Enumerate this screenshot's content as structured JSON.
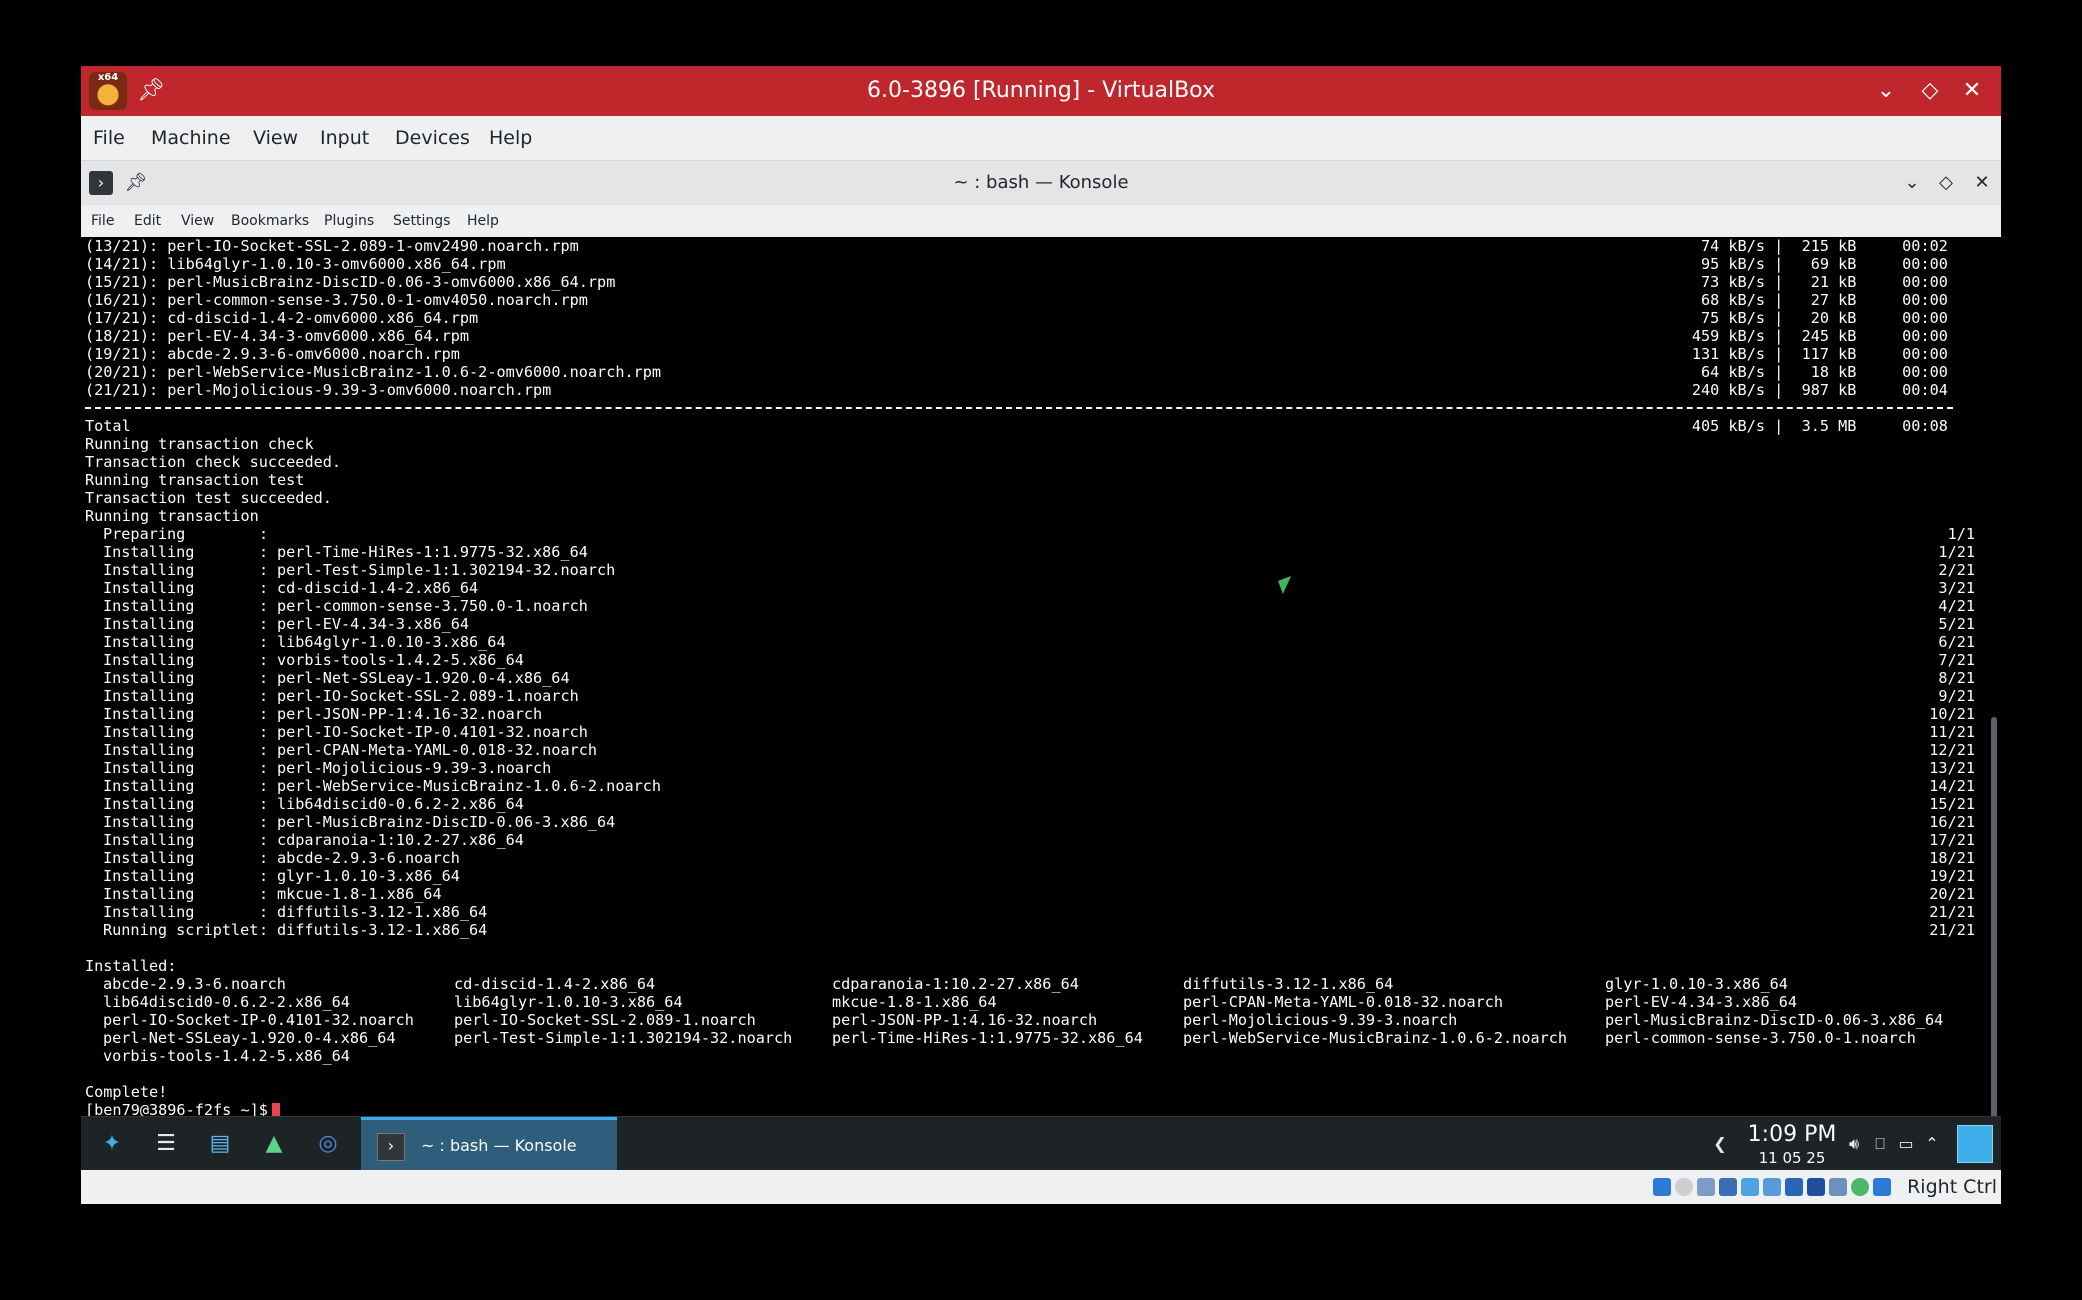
{
  "vbox": {
    "title": "6.0-3896 [Running] - VirtualBox",
    "icon_text": "x64",
    "menu": [
      "File",
      "Machine",
      "View",
      "Input",
      "Devices",
      "Help"
    ],
    "host_key": "Right Ctrl"
  },
  "konsole": {
    "title": "~ : bash — Konsole",
    "menu": [
      "File",
      "Edit",
      "View",
      "Bookmarks",
      "Plugins",
      "Settings",
      "Help"
    ]
  },
  "terminal": {
    "downloads": [
      {
        "name": "(13/21): perl-IO-Socket-SSL-2.089-1-omv2490.noarch.rpm",
        "speed": "74 kB/s",
        "size": "215 kB",
        "time": "00:02"
      },
      {
        "name": "(14/21): lib64glyr-1.0.10-3-omv6000.x86_64.rpm",
        "speed": "95 kB/s",
        "size": "69 kB",
        "time": "00:00"
      },
      {
        "name": "(15/21): perl-MusicBrainz-DiscID-0.06-3-omv6000.x86_64.rpm",
        "speed": "73 kB/s",
        "size": "21 kB",
        "time": "00:00"
      },
      {
        "name": "(16/21): perl-common-sense-3.750.0-1-omv4050.noarch.rpm",
        "speed": "68 kB/s",
        "size": "27 kB",
        "time": "00:00"
      },
      {
        "name": "(17/21): cd-discid-1.4-2-omv6000.x86_64.rpm",
        "speed": "75 kB/s",
        "size": "20 kB",
        "time": "00:00"
      },
      {
        "name": "(18/21): perl-EV-4.34-3-omv6000.x86_64.rpm",
        "speed": "459 kB/s",
        "size": "245 kB",
        "time": "00:00"
      },
      {
        "name": "(19/21): abcde-2.9.3-6-omv6000.noarch.rpm",
        "speed": "131 kB/s",
        "size": "117 kB",
        "time": "00:00"
      },
      {
        "name": "(20/21): perl-WebService-MusicBrainz-1.0.6-2-omv6000.noarch.rpm",
        "speed": "64 kB/s",
        "size": "18 kB",
        "time": "00:00"
      },
      {
        "name": "(21/21): perl-Mojolicious-9.39-3-omv6000.noarch.rpm",
        "speed": "240 kB/s",
        "size": "987 kB",
        "time": "00:04"
      }
    ],
    "total": {
      "label": "Total",
      "speed": "405 kB/s",
      "size": "3.5 MB",
      "time": "00:08"
    },
    "status_lines": [
      "Running transaction check",
      "Transaction check succeeded.",
      "Running transaction test",
      "Transaction test succeeded.",
      "Running transaction"
    ],
    "steps": [
      {
        "action": "Preparing",
        "pkg": "",
        "progress": "1/1"
      },
      {
        "action": "Installing",
        "pkg": "perl-Time-HiRes-1:1.9775-32.x86_64",
        "progress": "1/21"
      },
      {
        "action": "Installing",
        "pkg": "perl-Test-Simple-1:1.302194-32.noarch",
        "progress": "2/21"
      },
      {
        "action": "Installing",
        "pkg": "cd-discid-1.4-2.x86_64",
        "progress": "3/21"
      },
      {
        "action": "Installing",
        "pkg": "perl-common-sense-3.750.0-1.noarch",
        "progress": "4/21"
      },
      {
        "action": "Installing",
        "pkg": "perl-EV-4.34-3.x86_64",
        "progress": "5/21"
      },
      {
        "action": "Installing",
        "pkg": "lib64glyr-1.0.10-3.x86_64",
        "progress": "6/21"
      },
      {
        "action": "Installing",
        "pkg": "vorbis-tools-1.4.2-5.x86_64",
        "progress": "7/21"
      },
      {
        "action": "Installing",
        "pkg": "perl-Net-SSLeay-1.920.0-4.x86_64",
        "progress": "8/21"
      },
      {
        "action": "Installing",
        "pkg": "perl-IO-Socket-SSL-2.089-1.noarch",
        "progress": "9/21"
      },
      {
        "action": "Installing",
        "pkg": "perl-JSON-PP-1:4.16-32.noarch",
        "progress": "10/21"
      },
      {
        "action": "Installing",
        "pkg": "perl-IO-Socket-IP-0.4101-32.noarch",
        "progress": "11/21"
      },
      {
        "action": "Installing",
        "pkg": "perl-CPAN-Meta-YAML-0.018-32.noarch",
        "progress": "12/21"
      },
      {
        "action": "Installing",
        "pkg": "perl-Mojolicious-9.39-3.noarch",
        "progress": "13/21"
      },
      {
        "action": "Installing",
        "pkg": "perl-WebService-MusicBrainz-1.0.6-2.noarch",
        "progress": "14/21"
      },
      {
        "action": "Installing",
        "pkg": "lib64discid0-0.6.2-2.x86_64",
        "progress": "15/21"
      },
      {
        "action": "Installing",
        "pkg": "perl-MusicBrainz-DiscID-0.06-3.x86_64",
        "progress": "16/21"
      },
      {
        "action": "Installing",
        "pkg": "cdparanoia-1:10.2-27.x86_64",
        "progress": "17/21"
      },
      {
        "action": "Installing",
        "pkg": "abcde-2.9.3-6.noarch",
        "progress": "18/21"
      },
      {
        "action": "Installing",
        "pkg": "glyr-1.0.10-3.x86_64",
        "progress": "19/21"
      },
      {
        "action": "Installing",
        "pkg": "mkcue-1.8-1.x86_64",
        "progress": "20/21"
      },
      {
        "action": "Installing",
        "pkg": "diffutils-3.12-1.x86_64",
        "progress": "21/21"
      },
      {
        "action": "Running scriptlet",
        "pkg": "diffutils-3.12-1.x86_64",
        "progress": "21/21"
      }
    ],
    "installed_header": "Installed:",
    "installed_rows": [
      [
        "abcde-2.9.3-6.noarch",
        "cd-discid-1.4-2.x86_64",
        "cdparanoia-1:10.2-27.x86_64",
        "diffutils-3.12-1.x86_64",
        "glyr-1.0.10-3.x86_64"
      ],
      [
        "lib64discid0-0.6.2-2.x86_64",
        "lib64glyr-1.0.10-3.x86_64",
        "mkcue-1.8-1.x86_64",
        "perl-CPAN-Meta-YAML-0.018-32.noarch",
        "perl-EV-4.34-3.x86_64"
      ],
      [
        "perl-IO-Socket-IP-0.4101-32.noarch",
        "perl-IO-Socket-SSL-2.089-1.noarch",
        "perl-JSON-PP-1:4.16-32.noarch",
        "perl-Mojolicious-9.39-3.noarch",
        "perl-MusicBrainz-DiscID-0.06-3.x86_64"
      ],
      [
        "perl-Net-SSLeay-1.920.0-4.x86_64",
        "perl-Test-Simple-1:1.302194-32.noarch",
        "perl-Time-HiRes-1:1.9775-32.x86_64",
        "perl-WebService-MusicBrainz-1.0.6-2.noarch",
        "perl-common-sense-3.750.0-1.noarch"
      ],
      [
        "vorbis-tools-1.4.2-5.x86_64",
        "",
        "",
        "",
        ""
      ]
    ],
    "complete": "Complete!",
    "prompt": "[ben79@3896-f2fs ~]$"
  },
  "taskbar": {
    "launchers": [
      "application-launcher-icon",
      "system-settings-icon",
      "file-manager-icon",
      "image-viewer-icon",
      "browser-icon"
    ],
    "task_label": "~ : bash — Konsole",
    "clock_time": "1:09 PM",
    "clock_date": "11 05 25"
  },
  "colors": {
    "vbox_titlebar": "#c0272d",
    "terminal_bg": "#000000",
    "terminal_fg": "#fcfcfc",
    "cursor": "#e4454f",
    "task_active": "#2e5e7c",
    "accent": "#3daee9"
  }
}
